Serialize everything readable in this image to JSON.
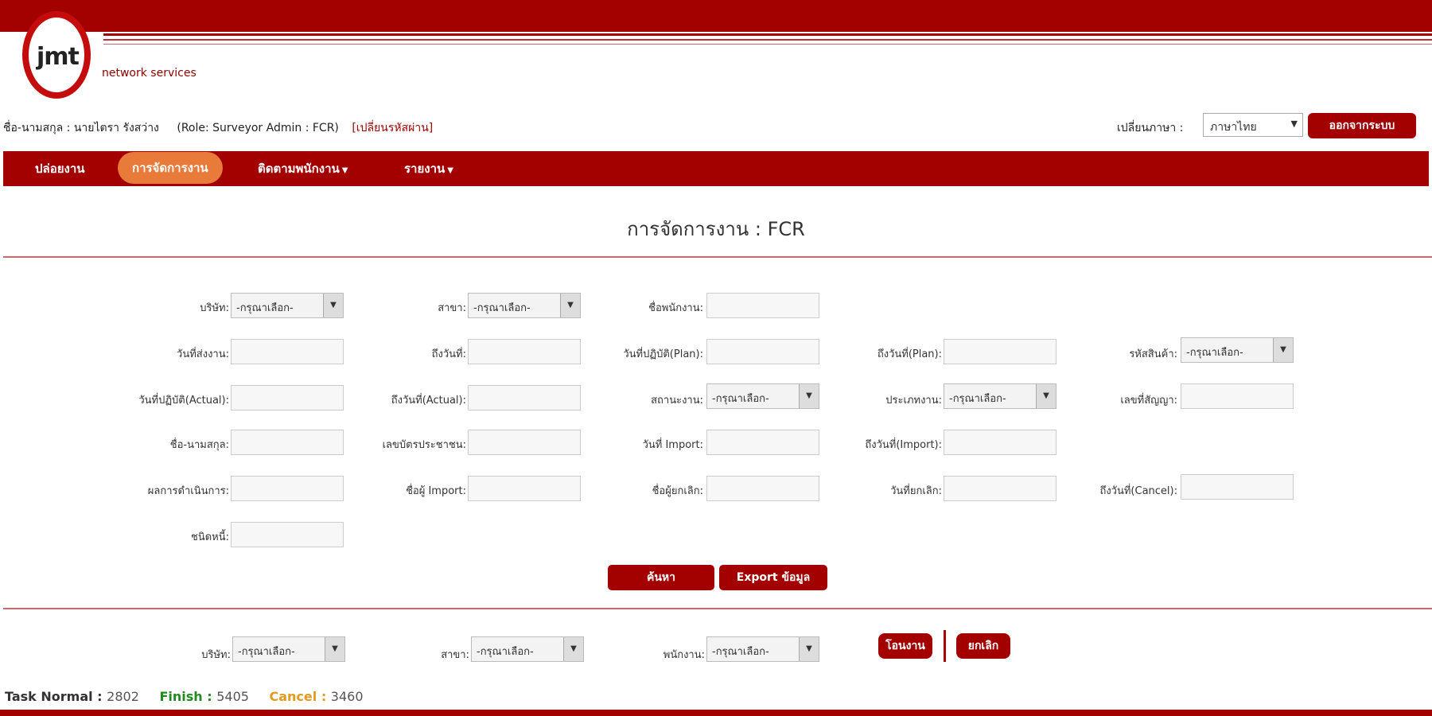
{
  "header": {
    "logo_text": "jmt",
    "logo_sub": "network services"
  },
  "user": {
    "name": "ชื่อ-นามสกุล : นายไตรา รังสว่าง",
    "role": "(Role: Surveyor Admin : FCR)",
    "change_link": "[เปลี่ยนรหัสผ่าน]"
  },
  "lang": {
    "label": "เปลี่ยนภาษา :",
    "selected": "ภาษาไทย"
  },
  "logout_label": "ออกจากระบบ",
  "nav": {
    "items": [
      {
        "label": "ปล่อยงาน",
        "active": false
      },
      {
        "label": "การจัดการงาน",
        "active": true
      },
      {
        "label": "ติดตามพนักงาน",
        "active": false,
        "dropdown": true
      },
      {
        "label": "รายงาน",
        "active": false,
        "dropdown": true
      }
    ]
  },
  "page_title": "การจัดการงาน  : FCR",
  "form": {
    "company_label": "บริษัท:",
    "company_value": "-กรุณาเลือก-",
    "branch_label": "สาขา:",
    "branch_value": "-กรุณาเลือก-",
    "employee_label": "ชื่อพนักงาน:",
    "send_date_label": "วันที่ส่งงาน:",
    "to_date_label": "ถึงวันที่:",
    "plan_date_label": "วันที่ปฏิบัติ(Plan):",
    "plan_to_label": "ถึงวันที่(Plan):",
    "product_label": "รหัสสินค้า:",
    "product_value": "-กรุณาเลือก-",
    "actual_date_label": "วันที่ปฏิบัติ(Actual):",
    "actual_to_label": "ถึงวันที่(Actual):",
    "status_label": "สถานะงาน:",
    "status_value": "-กรุณาเลือก-",
    "type_label": "ประเภทงาน:",
    "type_value": "-กรุณาเลือก-",
    "contract_label": "เลขที่สัญญา:",
    "customer_label": "ชื่อ-นามสกุล:",
    "idcard_label": "เลขบัตรประชาชน:",
    "import_date_label": "วันที่ Import:",
    "import_to_label": "ถึงวันที่(Import):",
    "result_label": "ผลการดำเนินการ:",
    "import_user_label": "ชื่อผู้ Import:",
    "cancel_user_label": "ชื่อผู้ยกเลิก:",
    "cancel_date_label": "วันที่ยกเลิก:",
    "cancel_to_label": "ถึงวันที่(Cancel):",
    "debt_label": "ชนิดหนี้:",
    "search_label": "ค้นหา",
    "export_label": "Export ข้อมูล"
  },
  "assign": {
    "company_label": "บริษัท:",
    "company_value": "-กรุณาเลือก-",
    "branch_label": "สาขา:",
    "branch_value": "-กรุณาเลือก-",
    "staff_label": "พนักงาน:",
    "staff_value": "-กรุณาเลือก-",
    "assign_label": "โอนงาน",
    "cancel_label": "ยกเลิก"
  },
  "status": {
    "normal_label": "Task Normal :",
    "normal_value": "2802",
    "finish_label": "Finish :",
    "finish_value": "5405",
    "cancel_label": "Cancel :",
    "cancel_value": "3460"
  },
  "colors": {
    "brand": "#a30000",
    "active_tab": "#e87a3a",
    "finish": "#228b22",
    "cancel": "#e39a1e"
  }
}
